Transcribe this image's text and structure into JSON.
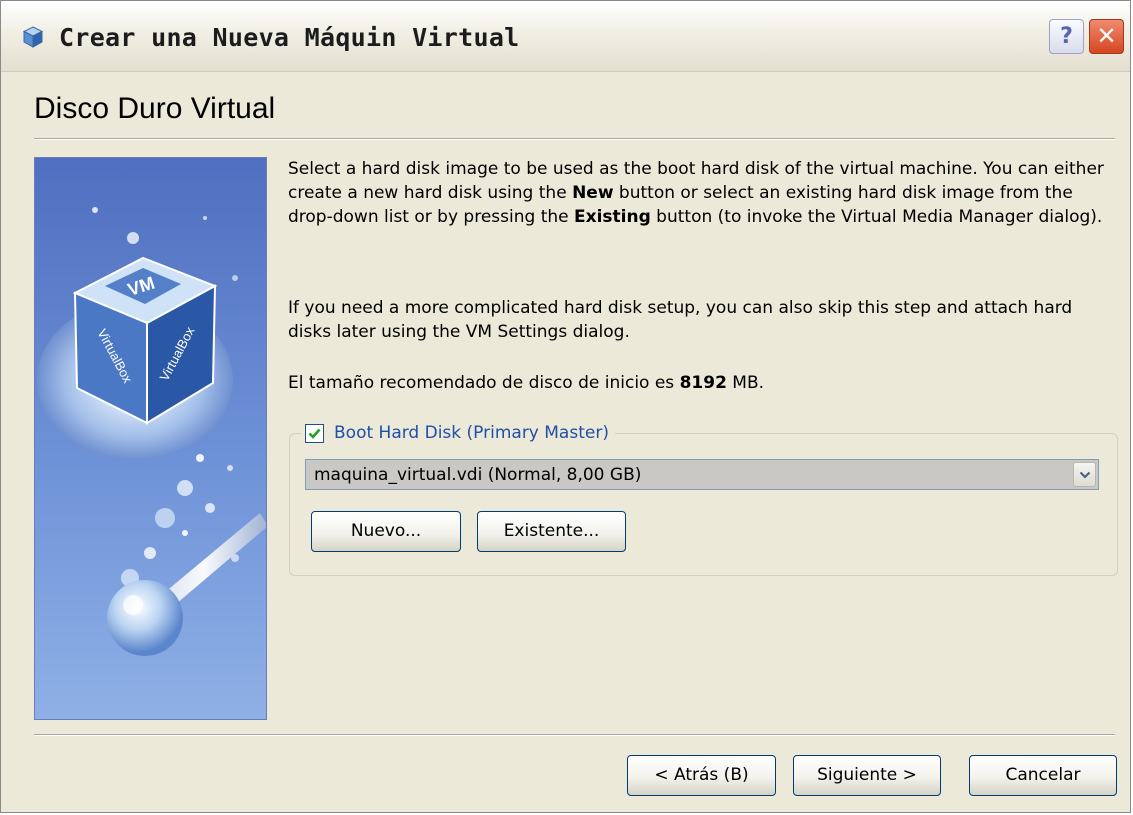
{
  "window": {
    "title": "Crear una Nueva Máquin Virtual",
    "help_label": "?",
    "close_label": "✕"
  },
  "page": {
    "heading": "Disco Duro Virtual"
  },
  "description": {
    "p1_a": "Select a hard disk image to be used as the boot hard disk of the virtual machine. You can either create a new hard disk using the ",
    "p1_new": "New",
    "p1_b": " button or select an existing hard disk image from the drop-down list or by pressing the ",
    "p1_existing": "Existing",
    "p1_c": " button (to invoke the Virtual Media Manager dialog).",
    "p2": "If you need a more complicated hard disk setup, you can also skip this step and attach hard disks later using the VM Settings dialog.",
    "p3_a": "El tamaño recomendado de disco de inicio es ",
    "p3_size": "8192",
    "p3_b": " MB."
  },
  "boot_disk": {
    "label": "Boot Hard Disk (Primary Master)",
    "checked": true,
    "selected": "maquina_virtual.vdi (Normal, 8,00 GB)",
    "new_label": "Nuevo...",
    "existing_label": "Existente..."
  },
  "nav": {
    "back_label": "< Atrás (B)",
    "next_label": "Siguiente >",
    "cancel_label": "Cancelar"
  },
  "side_image": {
    "cube_text_top": "VM",
    "cube_text_left": "VirtualBox",
    "cube_text_right": "VirtualBox"
  },
  "colors": {
    "dialog_bg": "#ece9d8",
    "legend_text": "#1f4fa8",
    "button_border": "#003c74",
    "close_red": "#d5461f"
  }
}
